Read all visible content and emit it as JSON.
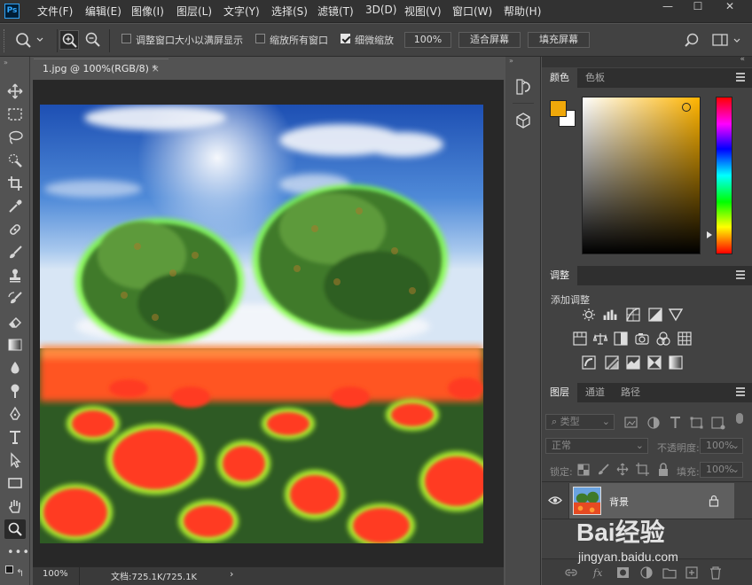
{
  "app": {
    "logo": "Ps"
  },
  "menu": [
    "文件(F)",
    "编辑(E)",
    "图像(I)",
    "图层(L)",
    "文字(Y)",
    "选择(S)",
    "滤镜(T)",
    "3D(D)",
    "视图(V)",
    "窗口(W)",
    "帮助(H)"
  ],
  "window_controls": {
    "minimize": "—",
    "maximize": "☐",
    "close": "✕"
  },
  "options": {
    "resize_windows": "调整窗口大小以满屏显示",
    "zoom_all": "缩放所有窗口",
    "scrubby_zoom": "细微缩放",
    "scrubby_checked": true,
    "zoom_value": "100%",
    "fit_screen": "适合屏幕",
    "fill_screen": "填充屏幕"
  },
  "document": {
    "tab_title": "1.jpg @ 100%(RGB/8) *",
    "close": "×"
  },
  "status": {
    "zoom": "100%",
    "doc_info": "文档:725.1K/725.1K",
    "arrow": "›"
  },
  "color_panel": {
    "tabs": [
      "颜色",
      "色板"
    ],
    "foreground": "#f0a80a",
    "background": "#ffffff",
    "picker_hue": "#ffb400"
  },
  "adjust_panel": {
    "tab": "调整",
    "title": "添加调整"
  },
  "layers_panel": {
    "tabs": [
      "图层",
      "通道",
      "路径"
    ],
    "filter": "类型",
    "blend_mode": "正常",
    "opacity_label": "不透明度:",
    "opacity_value": "100%",
    "lock_label": "锁定:",
    "fill_label": "填充:",
    "fill_value": "100%",
    "layer_name": "背景"
  },
  "watermark": {
    "text": "Bai经验",
    "url": "jingyan.baidu.com"
  }
}
